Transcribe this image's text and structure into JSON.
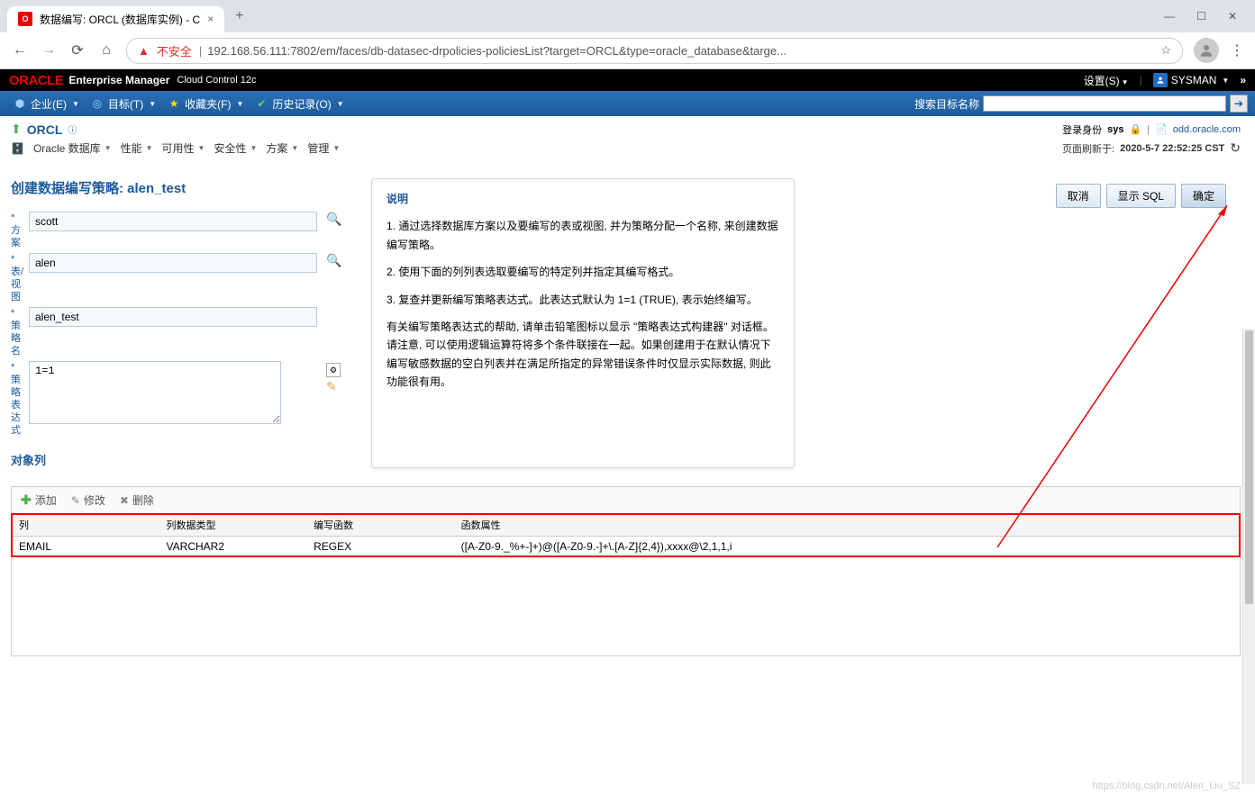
{
  "browser": {
    "tab_title": "数据编写: ORCL (数据库实例) - C",
    "url_insecure": "不安全",
    "url": "192.168.56.111:7802/em/faces/db-datasec-drpolicies-policiesList?target=ORCL&type=oracle_database&targe..."
  },
  "oracle_header": {
    "logo": "ORACLE",
    "product": "Enterprise Manager",
    "subtitle": "Cloud Control 12c",
    "settings": "设置(S)",
    "username": "SYSMAN"
  },
  "oracle_menu": {
    "items": [
      {
        "label": "企业(E)"
      },
      {
        "label": "目标(T)"
      },
      {
        "label": "收藏夹(F)"
      },
      {
        "label": "历史记录(O)"
      }
    ],
    "search_label": "搜索目标名称"
  },
  "orcl": {
    "title": "ORCL",
    "login_label": "登录身份",
    "login_user": "sys",
    "host": "odd.oracle.com"
  },
  "db_menu": {
    "items": [
      "Oracle 数据库",
      "性能",
      "可用性",
      "安全性",
      "方案",
      "管理"
    ],
    "refresh_label": "页面刷新于:",
    "refresh_time": "2020-5-7 22:52:25 CST"
  },
  "page": {
    "title": "创建数据编写策略: alen_test",
    "actions": {
      "cancel": "取消",
      "show_sql": "显示 SQL",
      "ok": "确定"
    }
  },
  "form": {
    "schema_label": "方案",
    "schema_value": "scott",
    "table_label": "表/视图",
    "table_value": "alen",
    "policy_label": "策略名",
    "policy_value": "alen_test",
    "expr_label": "策略表达式",
    "expr_value": "1=1"
  },
  "description": {
    "title": "说明",
    "p1": "1. 通过选择数据库方案以及要编写的表或视图, 并为策略分配一个名称, 来创建数据编写策略。",
    "p2": "2. 使用下面的列列表选取要编写的特定列并指定其编写格式。",
    "p3": "3. 复查并更新编写策略表达式。此表达式默认为 1=1 (TRUE), 表示始终编写。",
    "p4": "有关编写策略表达式的帮助, 请单击铅笔图标以显示 \"策略表达式构建器\" 对话框。请注意, 可以使用逻辑运算符将多个条件联接在一起。如果创建用于在默认情况下编写敏感数据的空白列表并在满足所指定的异常错误条件时仅显示实际数据, 则此功能很有用。"
  },
  "section": {
    "columns_title": "对象列"
  },
  "toolbar": {
    "add": "添加",
    "edit": "修改",
    "delete": "删除"
  },
  "table": {
    "headers": {
      "col": "列",
      "type": "列数据类型",
      "func": "编写函数",
      "attr": "函数属性"
    },
    "rows": [
      {
        "col": "EMAIL",
        "type": "VARCHAR2",
        "func": "REGEX",
        "attr": "([A-Z0-9._%+-]+)@([A-Z0-9.-]+\\.[A-Z]{2,4}),xxxx@\\2,1,1,i"
      }
    ]
  },
  "watermark": "https://blog.csdn.net/Alen_Liu_SZ"
}
